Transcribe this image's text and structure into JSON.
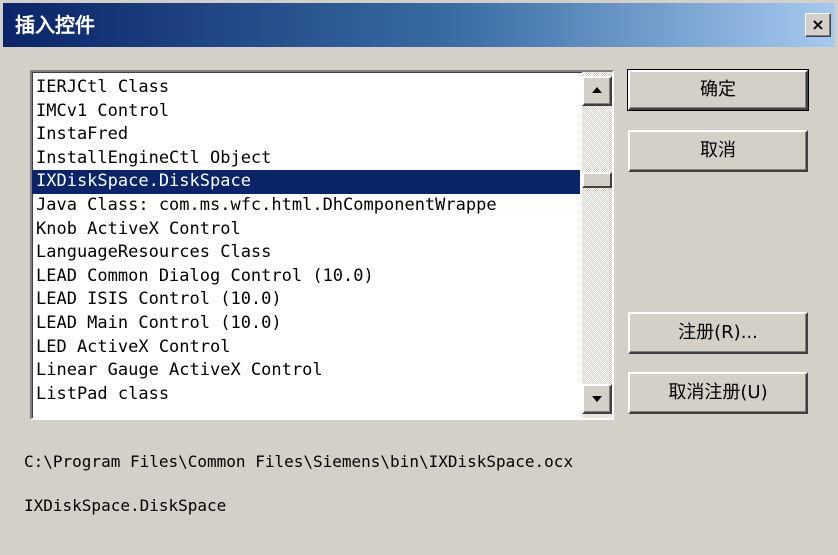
{
  "window": {
    "title": "插入控件",
    "close_label": "×"
  },
  "list": {
    "items": [
      "IERJCtl Class",
      "IMCv1 Control",
      "InstaFred",
      "InstallEngineCtl Object",
      "IXDiskSpace.DiskSpace",
      "Java Class: com.ms.wfc.html.DhComponentWrappe",
      "Knob ActiveX Control",
      "LanguageResources Class",
      "LEAD Common Dialog Control (10.0)",
      "LEAD ISIS Control (10.0)",
      "LEAD Main Control (10.0)",
      "LED ActiveX Control",
      "Linear Gauge ActiveX Control",
      "ListPad class"
    ],
    "selected_index": 4
  },
  "buttons": {
    "ok": "确定",
    "cancel": "取消",
    "register": "注册(R)...",
    "unregister": "取消注册(U)"
  },
  "info": {
    "path": "C:\\Program Files\\Common Files\\Siemens\\bin\\IXDiskSpace.ocx",
    "class_name": "IXDiskSpace.DiskSpace"
  },
  "icons": {
    "scroll_up": "triangle-up",
    "scroll_down": "triangle-down",
    "close": "x"
  },
  "colors": {
    "title_start": "#0a246a",
    "title_end": "#a6caf0",
    "selection": "#0a246a",
    "face": "#d4d0c8"
  }
}
